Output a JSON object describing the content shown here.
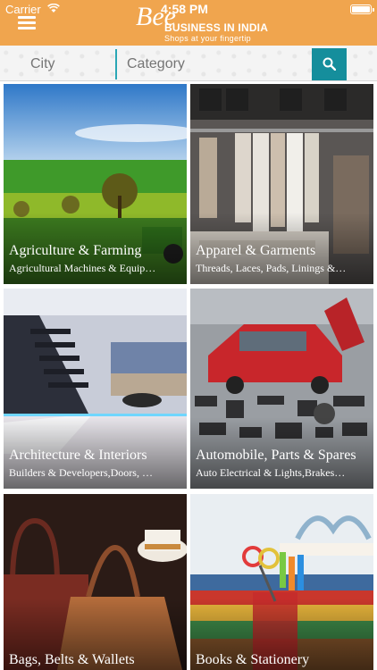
{
  "status_bar": {
    "carrier": "Carrier",
    "time": "4:58 PM"
  },
  "header": {
    "logo_mark": "Bee",
    "logo_title": "BUSINESS IN INDIA",
    "logo_tagline": "Shops at your fingertip",
    "accent_color": "#f0a54e"
  },
  "search": {
    "city_placeholder": "City",
    "category_placeholder": "Category",
    "button_color": "#158e9c"
  },
  "categories": [
    {
      "title": "Agriculture & Farming",
      "subtitle": "Agricultural Machines & Equip…"
    },
    {
      "title": "Apparel & Garments",
      "subtitle": "Threads, Laces, Pads, Linings &…"
    },
    {
      "title": "Architecture & Interiors",
      "subtitle": "Builders & Developers,Doors, …"
    },
    {
      "title": "Automobile, Parts & Spares",
      "subtitle": "Auto Electrical & Lights,Brakes…"
    },
    {
      "title": "Bags, Belts & Wallets",
      "subtitle": ""
    },
    {
      "title": "Books & Stationery",
      "subtitle": ""
    }
  ]
}
